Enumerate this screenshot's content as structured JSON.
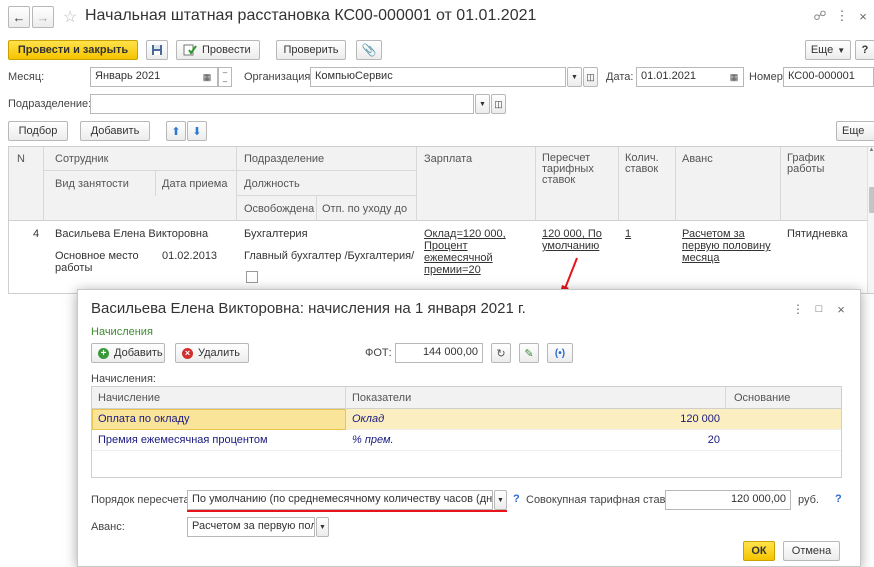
{
  "window": {
    "title": "Начальная штатная расстановка КС00-000001 от 01.01.2021"
  },
  "toolbar": {
    "post_close": "Провести и закрыть",
    "post": "Провести",
    "check": "Проверить",
    "more": "Еще",
    "help": "?"
  },
  "header": {
    "month_label": "Месяц:",
    "month_value": "Январь 2021",
    "org_label": "Организация:",
    "org_value": "КомпьюСервис",
    "date_label": "Дата:",
    "date_value": "01.01.2021",
    "number_label": "Номер:",
    "number_value": "КС00-000001",
    "dept_label": "Подразделение:",
    "dept_value": ""
  },
  "table_toolbar": {
    "pick": "Подбор",
    "add": "Добавить",
    "more": "Еще"
  },
  "table": {
    "columns": {
      "n": "N",
      "employee": "Сотрудник",
      "employment": "Вид занятости",
      "hire_date": "Дата приема",
      "dept": "Подразделение",
      "position": "Должность",
      "released": "Освобождена",
      "leave": "Отп. по уходу до",
      "salary": "Зарплата",
      "recalc": "Пересчет тарифных ставок",
      "rate_count": "Колич. ставок",
      "advance": "Аванс",
      "schedule": "График работы"
    },
    "row": {
      "n": "4",
      "employee": "Васильева Елена Викторовна",
      "employment": "Основное место работы",
      "hire_date": "01.02.2013",
      "dept": "Бухгалтерия",
      "position": "Главный бухгалтер /Бухгалтерия/",
      "salary": "Оклад=120 000, Процент ежемесячной премии=20",
      "recalc": "120 000, По умолчанию",
      "rate_count": "1",
      "advance": "Расчетом за первую половину месяца",
      "schedule": "Пятидневка"
    }
  },
  "dialog": {
    "title": "Васильева Елена Викторовна: начисления на 1 января 2021 г.",
    "section": "Начисления",
    "add": "Добавить",
    "delete": "Удалить",
    "fot_label": "ФОТ:",
    "fot_value": "144 000,00",
    "accruals_label": "Начисления:",
    "columns": {
      "accrual": "Начисление",
      "indicators": "Показатели",
      "basis": "Основание"
    },
    "rows": [
      {
        "name": "Оплата по окладу",
        "indicator": "Оклад",
        "value": "120 000"
      },
      {
        "name": "Премия ежемесячная процентом",
        "indicator": "% прем.",
        "value": "20"
      }
    ],
    "recalc_label": "Порядок пересчета:",
    "recalc_value": "По умолчанию (по среднемесячному количеству часов (дней)",
    "total_rate_label": "Совокупная тарифная ставка:",
    "total_rate_value": "120 000,00",
    "currency": "руб.",
    "advance_label": "Аванс:",
    "advance_value": "Расчетом за первую полс",
    "ok": "ОК",
    "cancel": "Отмена",
    "help": "?"
  },
  "colors": {
    "accent_yellow": "#f5c400",
    "selected_row": "#fbeec0",
    "highlight_red": "#e8141c",
    "section_green": "#3f8c2f"
  }
}
